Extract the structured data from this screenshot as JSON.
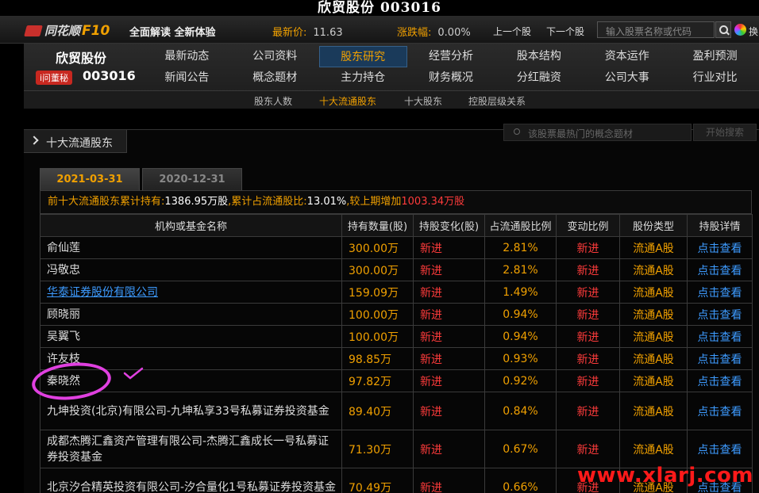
{
  "window": {
    "title": "欣贸股份 003016"
  },
  "topbar": {
    "brand": "同花顺",
    "f10": "F10",
    "slogan": "全面解读 全新体验",
    "latest_price_label": "最新价:",
    "latest_price": "11.63",
    "change_label": "涨跌幅:",
    "change_value": "0.00%",
    "prev_label": "上一个股",
    "next_label": "下一个股",
    "search_placeholder": "输入股票名称或代码",
    "skin_label": "换"
  },
  "stock": {
    "name": "欣贸股份",
    "ask_label": "i问董秘",
    "code": "003016"
  },
  "nav": {
    "row1": [
      "最新动态",
      "公司资料",
      "股东研究",
      "经营分析",
      "股本结构",
      "资本运作",
      "盈利预测"
    ],
    "row2": [
      "新闻公告",
      "概念题材",
      "主力持仓",
      "财务概况",
      "分红融资",
      "公司大事",
      "行业对比"
    ],
    "active": "股东研究"
  },
  "subnav": {
    "items": [
      "股东人数",
      "十大流通股东",
      "十大股东",
      "控股层级关系"
    ],
    "active": "十大流通股东"
  },
  "section": {
    "title": "十大流通股东",
    "concept_search_placeholder": "该股票最热门的概念题材",
    "concept_search_button": "开始搜索"
  },
  "tabs": {
    "active": "2021-03-31",
    "inactive": "2020-12-31"
  },
  "summary": {
    "prefix": "前十大流通股东累计持有:",
    "total_shares": "1386.95万股",
    "ratio_label": ",累计占流通股比:",
    "ratio": "13.01%",
    "compare_label": ",较上期增加",
    "increase": "1003.34万股"
  },
  "table": {
    "headers": [
      "机构或基金名称",
      "持有数量(股)",
      "持股变化(股)",
      "占流通股比例",
      "变动比例",
      "股份类型",
      "持股详情"
    ],
    "rows": [
      {
        "name": "俞仙莲",
        "amount": "300.00万",
        "change": "新进",
        "pct": "2.81%",
        "change_ratio": "新进",
        "type": "流通A股",
        "detail": "点击查看",
        "link": false
      },
      {
        "name": "冯敬忠",
        "amount": "300.00万",
        "change": "新进",
        "pct": "2.81%",
        "change_ratio": "新进",
        "type": "流通A股",
        "detail": "点击查看",
        "link": false
      },
      {
        "name": "华泰证券股份有限公司",
        "amount": "159.09万",
        "change": "新进",
        "pct": "1.49%",
        "change_ratio": "新进",
        "type": "流通A股",
        "detail": "点击查看",
        "link": true
      },
      {
        "name": "顾晓丽",
        "amount": "100.00万",
        "change": "新进",
        "pct": "0.94%",
        "change_ratio": "新进",
        "type": "流通A股",
        "detail": "点击查看",
        "link": false
      },
      {
        "name": "吴翼飞",
        "amount": "100.00万",
        "change": "新进",
        "pct": "0.94%",
        "change_ratio": "新进",
        "type": "流通A股",
        "detail": "点击查看",
        "link": false
      },
      {
        "name": "许友枝",
        "amount": "98.85万",
        "change": "新进",
        "pct": "0.93%",
        "change_ratio": "新进",
        "type": "流通A股",
        "detail": "点击查看",
        "link": false
      },
      {
        "name": "秦晓然",
        "amount": "97.82万",
        "change": "新进",
        "pct": "0.92%",
        "change_ratio": "新进",
        "type": "流通A股",
        "detail": "点击查看",
        "link": false
      },
      {
        "name": "九坤投资(北京)有限公司-九坤私享33号私募证券投资基金",
        "amount": "89.40万",
        "change": "新进",
        "pct": "0.84%",
        "change_ratio": "新进",
        "type": "流通A股",
        "detail": "点击查看",
        "link": false
      },
      {
        "name": "成都杰腾汇鑫资产管理有限公司-杰腾汇鑫成长一号私募证券投资基金",
        "amount": "71.30万",
        "change": "新进",
        "pct": "0.67%",
        "change_ratio": "新进",
        "type": "流通A股",
        "detail": "点击查看",
        "link": false
      },
      {
        "name": "北京汐合精英投资有限公司-汐合量化1号私募证券投资基金",
        "amount": "70.49万",
        "change": "新进",
        "pct": "0.66%",
        "change_ratio": "新进",
        "type": "流通A股",
        "detail": "点击查看",
        "link": false
      }
    ]
  },
  "watermark": "www.xlarj.com",
  "colors": {
    "accent": "#f0a000",
    "red": "#ff3b3b",
    "link": "#3d9bff",
    "annotation": "#e040e0"
  }
}
